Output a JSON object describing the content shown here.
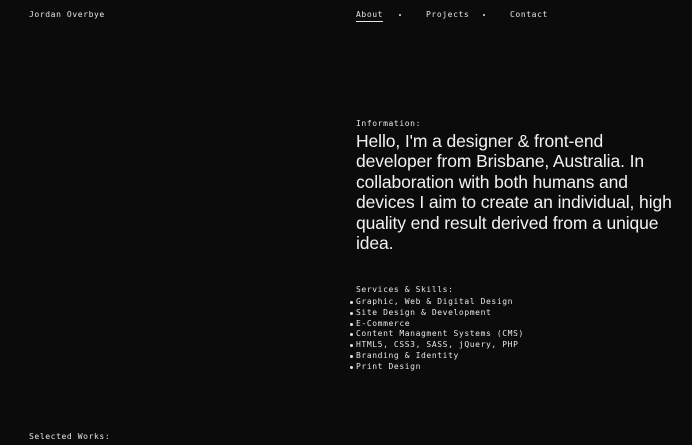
{
  "header": {
    "site_name": "Jordan Overbye"
  },
  "nav": {
    "items": [
      {
        "label": "About"
      },
      {
        "label": "Projects"
      },
      {
        "label": "Contact"
      }
    ]
  },
  "info": {
    "label": "Information:",
    "intro": "Hello, I'm a designer & front-end developer from Brisbane, Australia. In collaboration with both humans and devices I aim to create an individual, high quality end result derived from a unique idea."
  },
  "services": {
    "label": "Services & Skills:",
    "items": [
      "Graphic, Web & Digital Design",
      "Site Design & Development",
      "E-Commerce",
      "Content Managment Systems (CMS)",
      "HTML5, CSS3, SASS, jQuery, PHP",
      "Branding & Identity",
      "Print Design"
    ]
  },
  "works": {
    "label": "Selected Works:"
  }
}
